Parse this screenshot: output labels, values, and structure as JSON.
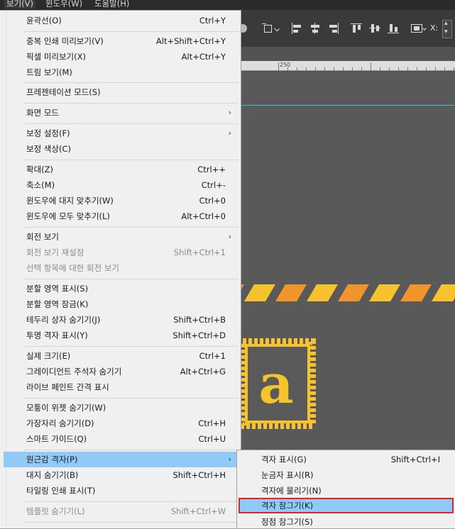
{
  "menubar": {
    "items": [
      {
        "label": "보기(V)"
      },
      {
        "label": "윈도우(W)"
      },
      {
        "label": "도움말(H)"
      }
    ]
  },
  "ruler": {
    "label": "250"
  },
  "view_menu": {
    "items": [
      {
        "label": "윤곽선(O)",
        "shortcut": "Ctrl+Y"
      },
      {
        "label": "중복 인쇄 미리보기(V)",
        "shortcut": "Alt+Shift+Ctrl+Y"
      },
      {
        "label": "픽셀 미리보기(X)",
        "shortcut": "Alt+Ctrl+Y"
      },
      {
        "label": "트림 보기(M)",
        "shortcut": ""
      },
      {
        "label": "프레젠테이션 모드(S)",
        "shortcut": ""
      },
      {
        "label": "화면 모드",
        "shortcut": "",
        "submenu": true
      },
      {
        "label": "보정 설정(F)",
        "shortcut": "",
        "submenu": true
      },
      {
        "label": "보정 색상(C)",
        "shortcut": ""
      },
      {
        "label": "확대(Z)",
        "shortcut": "Ctrl++"
      },
      {
        "label": "축소(M)",
        "shortcut": "Ctrl+-"
      },
      {
        "label": "윈도우에 대지 맞추기(W)",
        "shortcut": "Ctrl+0"
      },
      {
        "label": "윈도우에 모두 맞추기(L)",
        "shortcut": "Alt+Ctrl+0"
      },
      {
        "label": "회전 보기",
        "shortcut": "",
        "submenu": true
      },
      {
        "label": "회전 보기 재설정",
        "shortcut": "Shift+Ctrl+1",
        "disabled": true
      },
      {
        "label": "선택 항목에 대한 회전 보기",
        "shortcut": "",
        "disabled": true
      },
      {
        "label": "분할 영역 표시(S)",
        "shortcut": ""
      },
      {
        "label": "분할 영역 잠금(K)",
        "shortcut": ""
      },
      {
        "label": "테두리 상자 숨기기(J)",
        "shortcut": "Shift+Ctrl+B"
      },
      {
        "label": "투명 격자 표시(Y)",
        "shortcut": "Shift+Ctrl+D"
      },
      {
        "label": "실제 크기(E)",
        "shortcut": "Ctrl+1"
      },
      {
        "label": "그레이디언트 주석자 숨기기",
        "shortcut": "Alt+Ctrl+G"
      },
      {
        "label": "라이브 페인트 간격 표시",
        "shortcut": ""
      },
      {
        "label": "모퉁이 위젯 숨기기(W)",
        "shortcut": ""
      },
      {
        "label": "가장자리 숨기기(D)",
        "shortcut": "Ctrl+H"
      },
      {
        "label": "스마트 가이드(Q)",
        "shortcut": "Ctrl+U"
      },
      {
        "label": "원근감 격자(P)",
        "shortcut": "",
        "submenu": true,
        "highlight": true
      },
      {
        "label": "대지 숨기기(B)",
        "shortcut": "Shift+Ctrl+H"
      },
      {
        "label": "타일링 인쇄 표시(T)",
        "shortcut": ""
      },
      {
        "label": "템플릿 숨기기(L)",
        "shortcut": "Shift+Ctrl+W",
        "disabled": true
      }
    ],
    "submenu_arrow": "›"
  },
  "perspective_submenu": {
    "items": [
      {
        "label": "격자 표시(G)",
        "shortcut": "Shift+Ctrl+I"
      },
      {
        "label": "눈금자 표시(R)",
        "shortcut": ""
      },
      {
        "label": "격자에 물리기(N)",
        "shortcut": ""
      },
      {
        "label": "격자 잠그기(K)",
        "shortcut": "",
        "highlight": true
      },
      {
        "label": "정점 잠그기(S)",
        "shortcut": ""
      }
    ]
  },
  "artwork": {
    "glyph": "a",
    "colors": {
      "yellow": "#f6c22d",
      "orange": "#f1942c",
      "stamp_fill": "#5a5a5a"
    }
  },
  "toolbar": {
    "coord_label": "X:"
  },
  "colors": {
    "highlight": "#91c9f7",
    "outline": "#e0262a",
    "guide": "#36c7d4"
  }
}
